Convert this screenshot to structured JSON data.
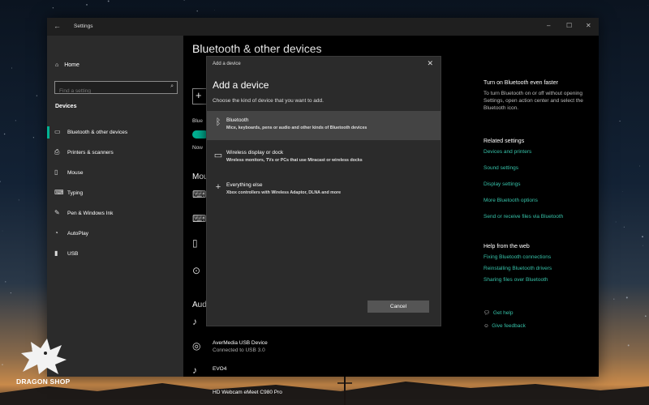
{
  "window": {
    "title": "Settings",
    "controls": {
      "minimize": "–",
      "maximize": "☐",
      "close": "✕"
    }
  },
  "sidebar": {
    "home_label": "Home",
    "search_placeholder": "Find a setting",
    "section_label": "Devices",
    "items": [
      {
        "label": "Bluetooth & other devices",
        "icon": "bluetooth-devices-icon",
        "active": true
      },
      {
        "label": "Printers & scanners",
        "icon": "printer-icon",
        "active": false
      },
      {
        "label": "Mouse",
        "icon": "mouse-icon",
        "active": false
      },
      {
        "label": "Typing",
        "icon": "keyboard-icon",
        "active": false
      },
      {
        "label": "Pen & Windows Ink",
        "icon": "pen-icon",
        "active": false
      },
      {
        "label": "AutoPlay",
        "icon": "autoplay-icon",
        "active": false
      },
      {
        "label": "USB",
        "icon": "usb-icon",
        "active": false
      }
    ]
  },
  "main": {
    "title": "Bluetooth & other devices",
    "bluetooth_label_fragment": "Blue",
    "now_fragment": "Now",
    "mouse_section_fragment": "Mou",
    "audio_section_fragment": "Audi",
    "devices": [
      {
        "name": "AverMedia USB Device",
        "status": "Connected to USB 3.0"
      },
      {
        "name": "EVO4",
        "status": ""
      },
      {
        "name": "HD Webcam eMeet C980 Pro",
        "status": ""
      }
    ]
  },
  "right_panel": {
    "tip_heading": "Turn on Bluetooth even faster",
    "tip_body": "To turn Bluetooth on or off without opening Settings, open action center and select the Bluetooth icon.",
    "related_heading": "Related settings",
    "related_links": [
      "Devices and printers",
      "Sound settings",
      "Display settings",
      "More Bluetooth options",
      "Send or receive files via Bluetooth"
    ],
    "help_heading": "Help from the web",
    "help_links": [
      "Fixing Bluetooth connections",
      "Reinstalling Bluetooth drivers",
      "Sharing files over Bluetooth"
    ],
    "get_help": "Get help",
    "give_feedback": "Give feedback"
  },
  "dialog": {
    "header": "Add a device",
    "title": "Add a device",
    "subtitle": "Choose the kind of device that you want to add.",
    "options": [
      {
        "title": "Bluetooth",
        "desc": "Mice, keyboards, pens or audio and other kinds of Bluetooth devices",
        "icon": "bluetooth-icon",
        "selected": true
      },
      {
        "title": "Wireless display or dock",
        "desc": "Wireless monitors, TVs or PCs that use Miracast or wireless docks",
        "icon": "monitor-icon",
        "selected": false
      },
      {
        "title": "Everything else",
        "desc": "Xbox controllers with Wireless Adaptor, DLNA and more",
        "icon": "plus-icon",
        "selected": false
      }
    ],
    "cancel_label": "Cancel"
  },
  "watermark": {
    "text": "DRAGON SHOP"
  },
  "colors": {
    "accent": "#00b294",
    "link": "#36c1a8",
    "sidebar_bg": "#2b2b2b",
    "dialog_bg": "#2b2b2b"
  }
}
